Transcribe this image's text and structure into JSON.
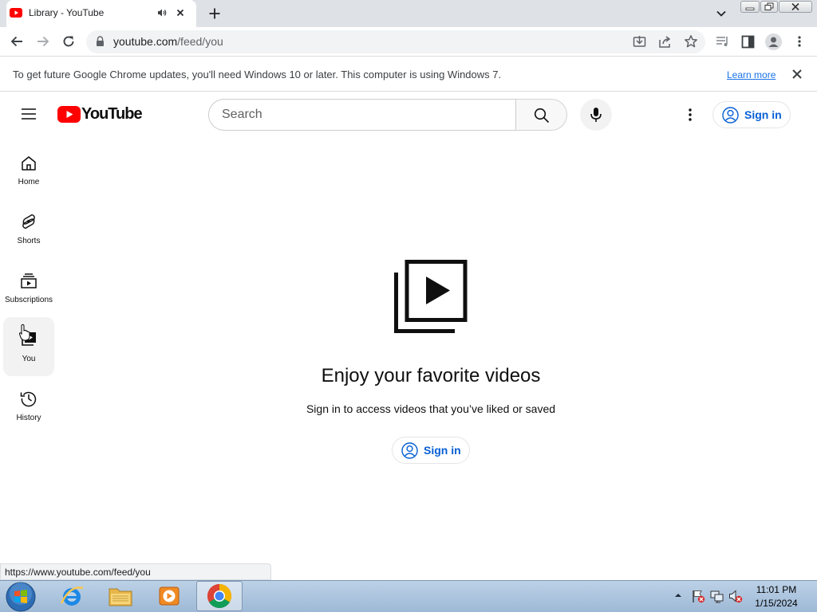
{
  "browser": {
    "tab": {
      "title": "Library - YouTube"
    },
    "address": {
      "host": "youtube.com",
      "path": "/feed/you"
    },
    "infobar": {
      "message": "To get future Google Chrome updates, you'll need Windows 10 or later. This computer is using Windows 7.",
      "link": "Learn more"
    },
    "status_url": "https://www.youtube.com/feed/you"
  },
  "youtube": {
    "logo_text": "YouTube",
    "search_placeholder": "Search",
    "signin_label": "Sign in",
    "sidebar": [
      {
        "label": "Home",
        "icon": "home-icon"
      },
      {
        "label": "Shorts",
        "icon": "shorts-icon"
      },
      {
        "label": "Subscriptions",
        "icon": "subscriptions-icon"
      },
      {
        "label": "You",
        "icon": "you-icon",
        "selected": true
      },
      {
        "label": "History",
        "icon": "history-icon"
      }
    ],
    "main": {
      "title": "Enjoy your favorite videos",
      "subtitle": "Sign in to access videos that you’ve liked or saved",
      "signin_label": "Sign in"
    }
  },
  "taskbar": {
    "time": "11:01 PM",
    "date": "1/15/2024"
  },
  "colors": {
    "youtube_red": "#ff0000",
    "link_blue": "#065fd4",
    "chrome_link": "#1a73e8"
  }
}
